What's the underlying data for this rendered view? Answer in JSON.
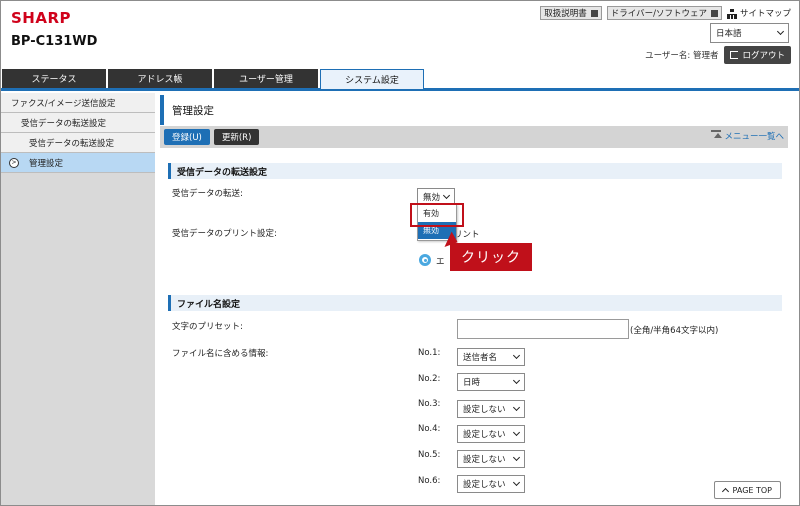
{
  "header": {
    "brand": "SHARP",
    "model": "BP-C131WD",
    "manual_link": "取扱説明書",
    "driver_link": "ドライバー/ソフトウェア",
    "sitemap_link": "サイトマップ",
    "language": "日本語",
    "user_label": "ユーザー名: 管理者",
    "logout_label": "ログアウト"
  },
  "tabs": [
    {
      "label": "ステータス"
    },
    {
      "label": "アドレス帳"
    },
    {
      "label": "ユーザー管理"
    },
    {
      "label": "システム設定"
    }
  ],
  "sidebar": {
    "items": [
      {
        "label": "ファクス/イメージ送信設定"
      },
      {
        "label": "受信データの転送設定"
      },
      {
        "label": "受信データの転送設定"
      },
      {
        "label": "管理設定"
      }
    ]
  },
  "main": {
    "title": "管理設定",
    "register_label": "登録(U)",
    "update_label": "更新(R)",
    "menu_link": "メニュー一覧へ",
    "section1": {
      "title": "受信データの転送設定",
      "transfer_label": "受信データの転送:",
      "transfer_value": "無効",
      "print_label": "受信データのプリント設定:",
      "print_partial": "リント",
      "radio_partial": "エ"
    },
    "dropdown": {
      "options": [
        "有効",
        "無効"
      ]
    },
    "annotation": {
      "callout": "クリック"
    },
    "section2": {
      "title": "ファイル名設定",
      "preset_label": "文字のプリセット:",
      "preset_hint": "(全角/半角64文字以内)",
      "include_label": "ファイル名に含める情報:",
      "rows": [
        {
          "no": "No.1:",
          "value": "送信者名"
        },
        {
          "no": "No.2:",
          "value": "日時"
        },
        {
          "no": "No.3:",
          "value": "設定しない"
        },
        {
          "no": "No.4:",
          "value": "設定しない"
        },
        {
          "no": "No.5:",
          "value": "設定しない"
        },
        {
          "no": "No.6:",
          "value": "設定しない"
        }
      ]
    },
    "page_top": "PAGE TOP"
  }
}
